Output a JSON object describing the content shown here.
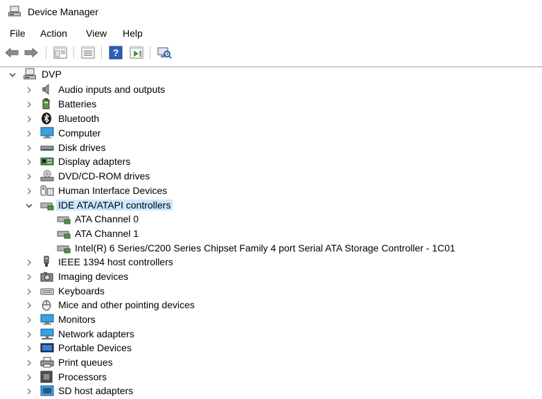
{
  "window": {
    "title": "Device Manager",
    "icon": "device-manager-icon"
  },
  "menu": [
    "File",
    "Action",
    "View",
    "Help"
  ],
  "toolbar": [
    "back-arrow-icon",
    "forward-arrow-icon",
    "show-hide-tree-icon",
    "properties-icon",
    "help-icon",
    "run-icon",
    "scan-hardware-icon"
  ],
  "tree": {
    "root": {
      "label": "DVP",
      "icon": "computer-root-icon",
      "expanded": true
    },
    "categories": [
      {
        "label": "Audio inputs and outputs",
        "icon": "speaker-icon",
        "expanded": false
      },
      {
        "label": "Batteries",
        "icon": "battery-icon",
        "expanded": false
      },
      {
        "label": "Bluetooth",
        "icon": "bluetooth-icon",
        "expanded": false
      },
      {
        "label": "Computer",
        "icon": "monitor-icon",
        "expanded": false
      },
      {
        "label": "Disk drives",
        "icon": "disk-drive-icon",
        "expanded": false
      },
      {
        "label": "Display adapters",
        "icon": "display-adapter-icon",
        "expanded": false
      },
      {
        "label": "DVD/CD-ROM drives",
        "icon": "dvd-drive-icon",
        "expanded": false
      },
      {
        "label": "Human Interface Devices",
        "icon": "hid-icon",
        "expanded": false
      },
      {
        "label": "IDE ATA/ATAPI controllers",
        "icon": "ide-controller-icon",
        "expanded": true,
        "selected": true,
        "children": [
          {
            "label": "ATA Channel 0",
            "icon": "ide-controller-icon"
          },
          {
            "label": "ATA Channel 1",
            "icon": "ide-controller-icon"
          },
          {
            "label": "Intel(R) 6 Series/C200 Series Chipset Family 4 port Serial ATA Storage Controller - 1C01",
            "icon": "ide-controller-icon"
          }
        ]
      },
      {
        "label": "IEEE 1394 host controllers",
        "icon": "ieee1394-icon",
        "expanded": false
      },
      {
        "label": "Imaging devices",
        "icon": "camera-icon",
        "expanded": false
      },
      {
        "label": "Keyboards",
        "icon": "keyboard-icon",
        "expanded": false
      },
      {
        "label": "Mice and other pointing devices",
        "icon": "mouse-icon",
        "expanded": false
      },
      {
        "label": "Monitors",
        "icon": "monitor-icon",
        "expanded": false
      },
      {
        "label": "Network adapters",
        "icon": "network-adapter-icon",
        "expanded": false
      },
      {
        "label": "Portable Devices",
        "icon": "portable-device-icon",
        "expanded": false
      },
      {
        "label": "Print queues",
        "icon": "printer-icon",
        "expanded": false
      },
      {
        "label": "Processors",
        "icon": "processor-icon",
        "expanded": false
      },
      {
        "label": "SD host adapters",
        "icon": "sd-adapter-icon",
        "expanded": false
      }
    ]
  },
  "colors": {
    "selection": "#cce8ff",
    "separator": "#9d9d9d"
  }
}
